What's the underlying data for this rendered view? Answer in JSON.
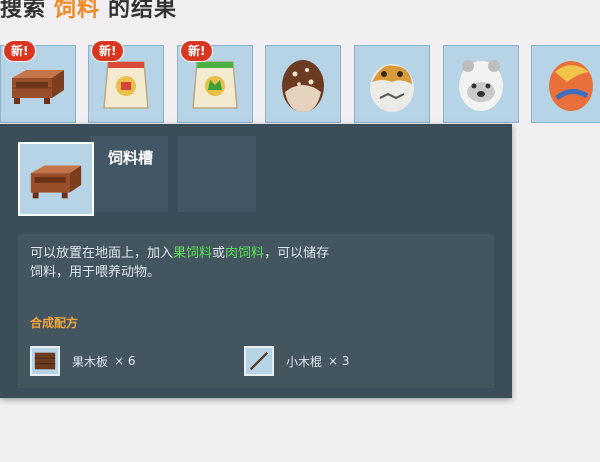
{
  "search": {
    "prefix": "搜索",
    "keyword": "饲料",
    "suffix": "的结果"
  },
  "items": [
    {
      "name": "饲料槽",
      "badge": "新!",
      "icon": "trough-icon"
    },
    {
      "name": "",
      "badge": "新!",
      "icon": "feed-bag-red-icon"
    },
    {
      "name": "",
      "badge": "新!",
      "icon": "feed-bag-green-icon"
    },
    {
      "name": "",
      "badge": "",
      "icon": "spotted-egg-icon"
    },
    {
      "name": "",
      "badge": "",
      "icon": "animal-egg-icon"
    },
    {
      "name": "",
      "badge": "",
      "icon": "bear-egg-icon"
    },
    {
      "name": "",
      "badge": "",
      "icon": "orange-egg-icon"
    }
  ],
  "tooltip": {
    "name": "饲料槽",
    "desc_part1": "可以放置在地面上，加入",
    "desc_link1": "果饲料",
    "desc_or": "或",
    "desc_link2": "肉饲料",
    "desc_part2": "，可以储存",
    "desc_line2": "饲料，用于喂养动物。",
    "recipe_title": "合成配方",
    "ingredients": [
      {
        "name": "果木板",
        "qty": "× 6",
        "icon": "fruit-wood-plank-icon"
      },
      {
        "name": "小木棍",
        "qty": "× 3",
        "icon": "small-stick-icon"
      }
    ]
  },
  "colors": {
    "keyword": "#f08a24",
    "highlight": "#5ee05a",
    "recipe": "#f0a43a",
    "badge": "#d9361f"
  }
}
